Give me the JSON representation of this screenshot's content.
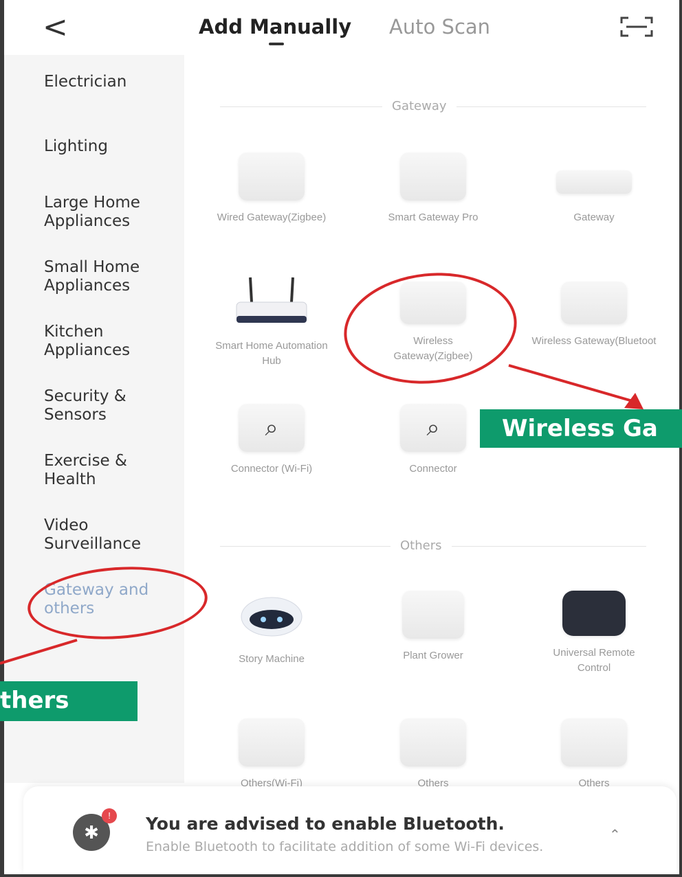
{
  "header": {
    "back_icon": "<",
    "tabs": [
      {
        "label": "Add Manually",
        "active": true
      },
      {
        "label": "Auto Scan",
        "active": false
      }
    ],
    "scan_icon": "scan-icon"
  },
  "sidebar": {
    "items": [
      {
        "label": "Electrician"
      },
      {
        "label": "Lighting"
      },
      {
        "label": "Large Home Appliances"
      },
      {
        "label": "Small Home Appliances"
      },
      {
        "label": "Kitchen Appliances"
      },
      {
        "label": "Security & Sensors"
      },
      {
        "label": "Exercise & Health"
      },
      {
        "label": "Video Surveillance"
      },
      {
        "label": "Gateway and others",
        "active": true
      }
    ]
  },
  "sections": {
    "gateway": {
      "title": "Gateway",
      "devices": [
        {
          "label": "Wired Gateway(Zigbee)"
        },
        {
          "label": "Smart Gateway Pro"
        },
        {
          "label": "Gateway"
        },
        {
          "label": "Smart Home Automation Hub"
        },
        {
          "label": "Wireless Gateway(Zigbee)"
        },
        {
          "label": "Wireless Gateway(Bluetoot"
        },
        {
          "label": "Connector (Wi-Fi)"
        },
        {
          "label": "Connector"
        }
      ]
    },
    "others": {
      "title": "Others",
      "devices": [
        {
          "label": "Story Machine"
        },
        {
          "label": "Plant Grower"
        },
        {
          "label": "Universal Remote Control"
        },
        {
          "label": "Others(Wi-Fi)"
        },
        {
          "label": "Others"
        },
        {
          "label": "Others"
        }
      ]
    }
  },
  "annotations": {
    "callout_wireless": "Wireless Ga",
    "callout_others": "thers",
    "color": "#d8282a",
    "callout_bg": "#0e9b6c"
  },
  "banner": {
    "title": "You are advised to enable Bluetooth.",
    "subtitle": "Enable Bluetooth to facilitate addition of some Wi-Fi devices.",
    "badge": "!",
    "icon": "bluetooth-icon"
  }
}
